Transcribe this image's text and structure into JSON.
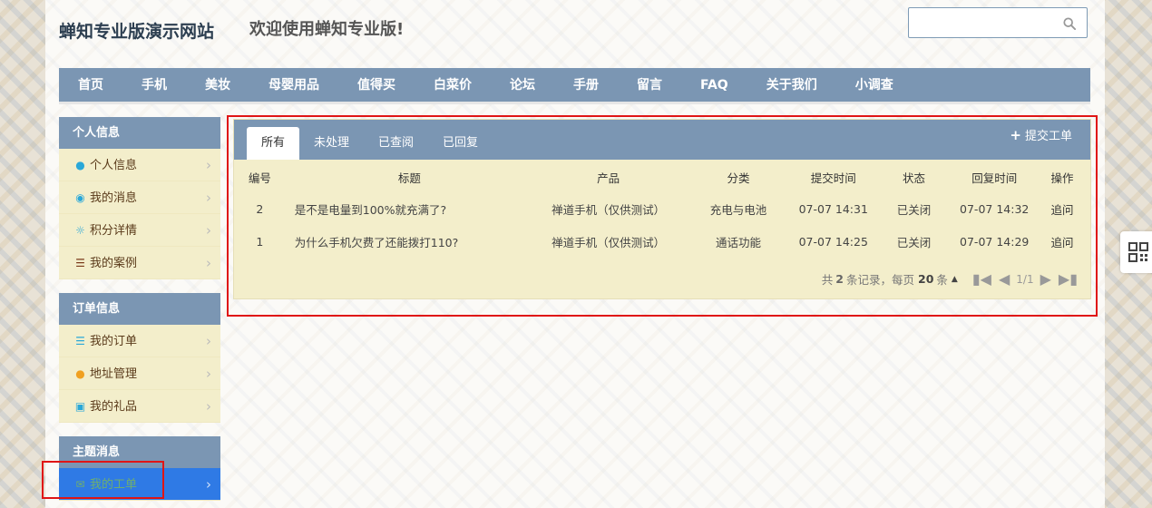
{
  "header": {
    "site_title": "蝉知专业版演示网站",
    "welcome": "欢迎使用蝉知专业版!",
    "search_placeholder": ""
  },
  "nav": [
    "首页",
    "手机",
    "美妆",
    "母婴用品",
    "值得买",
    "白菜价",
    "论坛",
    "手册",
    "留言",
    "FAQ",
    "关于我们",
    "小调查"
  ],
  "sidebar": {
    "personal": {
      "title": "个人信息",
      "items": [
        {
          "label": "个人信息",
          "icon": "user-icon"
        },
        {
          "label": "我的消息",
          "icon": "comment-icon"
        },
        {
          "label": "积分详情",
          "icon": "sun-icon"
        },
        {
          "label": "我的案例",
          "icon": "list-icon"
        }
      ]
    },
    "orders": {
      "title": "订单信息",
      "items": [
        {
          "label": "我的订单",
          "icon": "th-list-icon"
        },
        {
          "label": "地址管理",
          "icon": "map-marker-icon"
        },
        {
          "label": "我的礼品",
          "icon": "gift-icon"
        }
      ]
    },
    "topics": {
      "title": "主题消息",
      "items": [
        {
          "label": "我的工单",
          "icon": "envelope-icon"
        }
      ]
    }
  },
  "tickets": {
    "tabs": [
      "所有",
      "未处理",
      "已查阅",
      "已回复"
    ],
    "active_tab": "所有",
    "submit_label": "提交工单",
    "columns": [
      "编号",
      "标题",
      "产品",
      "分类",
      "提交时间",
      "状态",
      "回复时间",
      "操作"
    ],
    "rows": [
      {
        "id": "2",
        "title": "是不是电量到100%就充满了?",
        "product": "禅道手机（仅供测试）",
        "category": "充电与电池",
        "submitted": "07-07 14:31",
        "status": "已关闭",
        "replied": "07-07 14:32",
        "action": "追问"
      },
      {
        "id": "1",
        "title": "为什么手机欠费了还能拨打110?",
        "product": "禅道手机（仅供测试）",
        "category": "通话功能",
        "submitted": "07-07 14:25",
        "status": "已关闭",
        "replied": "07-07 14:29",
        "action": "追问"
      }
    ],
    "pager": {
      "prefix": "共",
      "total": "2",
      "records_label": "条记录，每页",
      "per_page": "20",
      "suffix": "条",
      "page_info": "1/1"
    }
  },
  "colors": {
    "nav_bg": "#7b96b3",
    "sidebar_item_bg": "#f3eecb",
    "active_item_bg": "#2f7ae5",
    "highlight_border": "#e01515"
  }
}
